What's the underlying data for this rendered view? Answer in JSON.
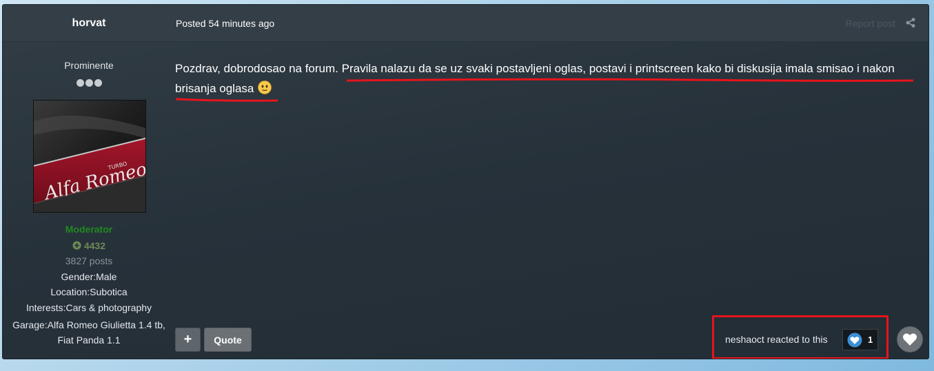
{
  "header": {
    "author": "horvat",
    "posted": "Posted 54 minutes ago",
    "report": "Report post",
    "share_icon": "share-icon"
  },
  "sidebar": {
    "rank_title": "Prominente",
    "role": "Moderator",
    "reputation": "4432",
    "posts": "3827 posts",
    "gender": "Gender:Male",
    "location": "Location:Subotica",
    "interests": "Interests:Cars & photography",
    "garage": "Garage:Alfa Romeo Giulietta 1.4 tb, Fiat Panda 1.1",
    "avatar_text": "Alfa Romeo"
  },
  "content": {
    "intro": "Pozdrav, dobrodosao na forum. ",
    "highlighted": "Pravila nalazu da se uz svaki postavljeni oglas, postavi i printscreen kako bi diskusija imala smisao i nakon brisanja oglasa",
    "emoji": "smiley-icon"
  },
  "actions": {
    "plus_label": "+",
    "quote_label": "Quote"
  },
  "reactions": {
    "text": "neshaoct reacted to this",
    "count": "1"
  },
  "colors": {
    "underline": "#e8141c",
    "moderator": "#1e8a1e",
    "reputation": "#6e8a56"
  }
}
